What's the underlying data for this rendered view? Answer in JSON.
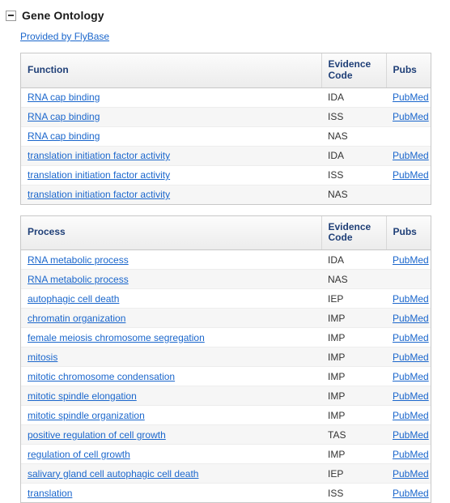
{
  "section": {
    "title": "Gene Ontology",
    "toggle_icon": "collapse-minus-icon",
    "toggle_state": "expanded",
    "provider_label": "Provided by FlyBase"
  },
  "colors": {
    "link": "#1a66cc",
    "header_text": "#1f3f77",
    "table_border": "#c8c8c8",
    "row_stripe": "#f6f6f6"
  },
  "tables": [
    {
      "id": "function-table",
      "columns": [
        "Function",
        "Evidence Code",
        "Pubs"
      ],
      "rows": [
        {
          "term": "RNA cap binding",
          "code": "IDA",
          "pubs": "PubMed"
        },
        {
          "term": "RNA cap binding",
          "code": "ISS",
          "pubs": "PubMed"
        },
        {
          "term": "RNA cap binding",
          "code": "NAS",
          "pubs": ""
        },
        {
          "term": "translation initiation factor activity",
          "code": "IDA",
          "pubs": "PubMed"
        },
        {
          "term": "translation initiation factor activity",
          "code": "ISS",
          "pubs": "PubMed"
        },
        {
          "term": "translation initiation factor activity",
          "code": "NAS",
          "pubs": ""
        }
      ]
    },
    {
      "id": "process-table",
      "columns": [
        "Process",
        "Evidence Code",
        "Pubs"
      ],
      "rows": [
        {
          "term": "RNA metabolic process",
          "code": "IDA",
          "pubs": "PubMed"
        },
        {
          "term": "RNA metabolic process",
          "code": "NAS",
          "pubs": ""
        },
        {
          "term": "autophagic cell death",
          "code": "IEP",
          "pubs": "PubMed"
        },
        {
          "term": "chromatin organization",
          "code": "IMP",
          "pubs": "PubMed"
        },
        {
          "term": "female meiosis chromosome segregation",
          "code": "IMP",
          "pubs": "PubMed"
        },
        {
          "term": "mitosis",
          "code": "IMP",
          "pubs": "PubMed"
        },
        {
          "term": "mitotic chromosome condensation",
          "code": "IMP",
          "pubs": "PubMed"
        },
        {
          "term": "mitotic spindle elongation",
          "code": "IMP",
          "pubs": "PubMed"
        },
        {
          "term": "mitotic spindle organization",
          "code": "IMP",
          "pubs": "PubMed"
        },
        {
          "term": "positive regulation of cell growth",
          "code": "TAS",
          "pubs": "PubMed"
        },
        {
          "term": "regulation of cell growth",
          "code": "IMP",
          "pubs": "PubMed"
        },
        {
          "term": "salivary gland cell autophagic cell death",
          "code": "IEP",
          "pubs": "PubMed"
        },
        {
          "term": "translation",
          "code": "ISS",
          "pubs": "PubMed"
        }
      ]
    }
  ]
}
